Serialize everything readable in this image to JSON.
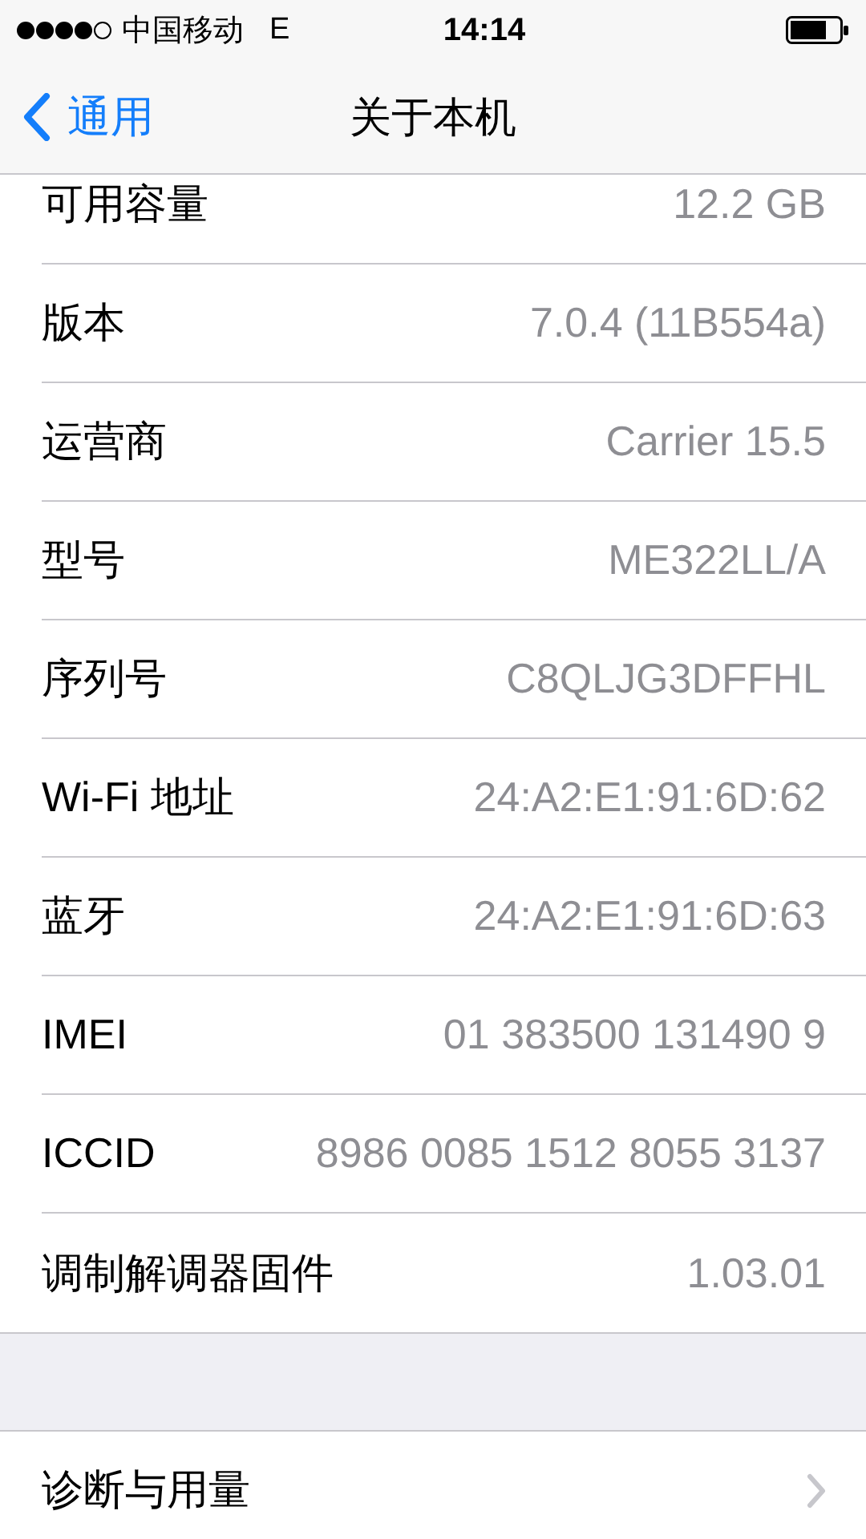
{
  "status_bar": {
    "carrier": "中国移动",
    "network": "E",
    "time": "14:14"
  },
  "nav": {
    "back": "通用",
    "title": "关于本机"
  },
  "rows": [
    {
      "label": "可用容量",
      "value": "12.2 GB"
    },
    {
      "label": "版本",
      "value": "7.0.4 (11B554a)"
    },
    {
      "label": "运营商",
      "value": "Carrier 15.5"
    },
    {
      "label": "型号",
      "value": "ME322LL/A"
    },
    {
      "label": "序列号",
      "value": "C8QLJG3DFFHL"
    },
    {
      "label": "Wi-Fi 地址",
      "value": "24:A2:E1:91:6D:62"
    },
    {
      "label": "蓝牙",
      "value": "24:A2:E1:91:6D:63"
    },
    {
      "label": "IMEI",
      "value": "01 383500 131490 9"
    },
    {
      "label": "ICCID",
      "value": "8986 0085 1512 8055 3137"
    },
    {
      "label": "调制解调器固件",
      "value": "1.03.01"
    }
  ],
  "links": [
    {
      "label": "诊断与用量"
    }
  ]
}
